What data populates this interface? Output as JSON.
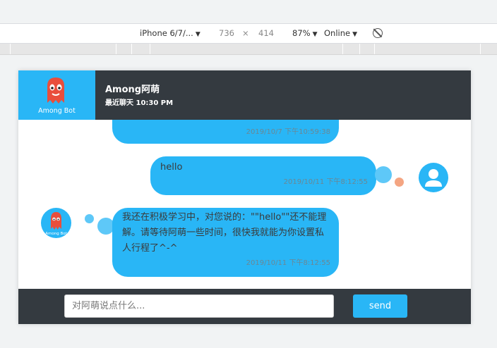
{
  "devtools": {
    "device": "iPhone 6/7/...",
    "width": "736",
    "times": "×",
    "height": "414",
    "zoom": "87%",
    "network": "Online"
  },
  "header": {
    "brand_name": "Among Bot",
    "title": "Among阿萌",
    "subtitle": "最近聊天 10:30 PM"
  },
  "avatar_bot_label": "Among Bot",
  "messages": [
    {
      "from": "bot",
      "text": "",
      "time": "2019/10/7 下午10:59:38"
    },
    {
      "from": "user",
      "text": "hello",
      "time": "2019/10/11 下午8:12:55"
    },
    {
      "from": "bot",
      "text": "我还在积极学习中，对您说的：\"\"hello\"\"还不能理解。请等待阿萌一些时间，很快我就能为你设置私人行程了^-^",
      "time": "2019/10/11 下午8:12:55"
    }
  ],
  "input": {
    "placeholder": "对阿萌说点什么..."
  },
  "send_label": "send",
  "colors": {
    "accent": "#29b6f6",
    "dark": "#343a40",
    "orange_dot": "#f4a582"
  }
}
